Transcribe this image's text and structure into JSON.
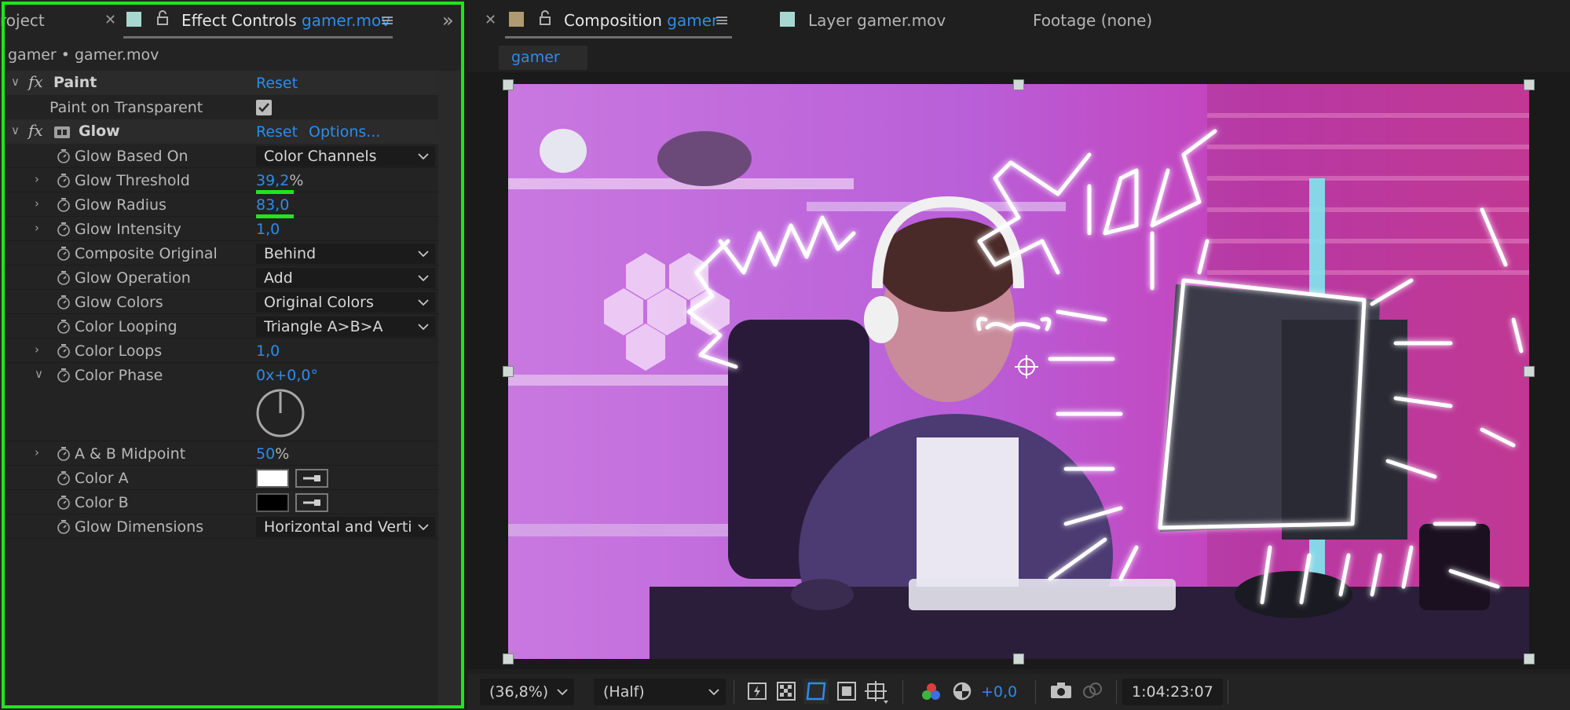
{
  "left_panel": {
    "tabs": {
      "project_label": "roject",
      "effect_controls_label": "Effect Controls",
      "effect_controls_target": "gamer.mov"
    },
    "layer_title": "gamer • gamer.mov",
    "paint": {
      "name": "Paint",
      "reset_label": "Reset",
      "paint_on_transparent_label": "Paint on Transparent",
      "paint_on_transparent_checked": true
    },
    "glow": {
      "name": "Glow",
      "reset_label": "Reset",
      "options_label": "Options...",
      "properties": {
        "based_on": {
          "label": "Glow Based On",
          "value": "Color Channels"
        },
        "threshold": {
          "label": "Glow Threshold",
          "value": "39,2",
          "unit": "%"
        },
        "radius": {
          "label": "Glow Radius",
          "value": "83,0"
        },
        "intensity": {
          "label": "Glow Intensity",
          "value": "1,0"
        },
        "composite": {
          "label": "Composite Original",
          "value": "Behind"
        },
        "operation": {
          "label": "Glow Operation",
          "value": "Add"
        },
        "colors": {
          "label": "Glow Colors",
          "value": "Original Colors"
        },
        "looping": {
          "label": "Color Looping",
          "value": "Triangle A>B>A"
        },
        "loops": {
          "label": "Color Loops",
          "value": "1,0"
        },
        "phase": {
          "label": "Color Phase",
          "value": "0x+0,0°"
        },
        "midpoint": {
          "label": "A & B Midpoint",
          "value": "50",
          "unit": "%"
        },
        "color_a": {
          "label": "Color A",
          "color": "#ffffff"
        },
        "color_b": {
          "label": "Color B",
          "color": "#000000"
        },
        "dimensions": {
          "label": "Glow Dimensions",
          "value": "Horizontal and Verti"
        }
      }
    }
  },
  "right_panel": {
    "tabs": {
      "composition_label": "Composition",
      "composition_target": "gamer",
      "layer_label": "Layer gamer.mov",
      "footage_label": "Footage (none)"
    },
    "comp_chip": "gamer",
    "toolbar": {
      "zoom": "(36,8%)",
      "resolution": "(Half)",
      "exposure": "+0,0",
      "timecode": "1:04:23:07"
    }
  },
  "colors": {
    "accent_blue": "#2d8ceb",
    "highlight_green": "#1fe41f",
    "effect_label_color": "#a6d8cf",
    "comp_label_color": "#b09a72"
  }
}
